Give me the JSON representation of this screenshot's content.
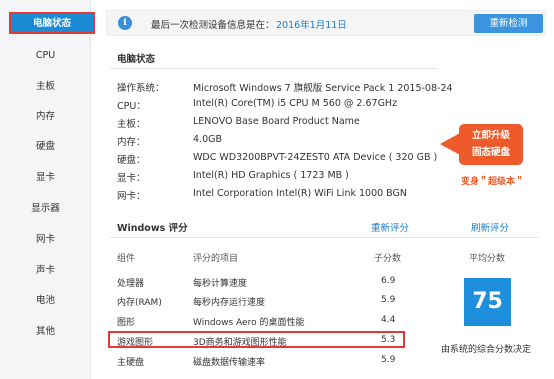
{
  "sidebar": {
    "items": [
      {
        "label": "电脑状态"
      },
      {
        "label": "CPU"
      },
      {
        "label": "主板"
      },
      {
        "label": "内存"
      },
      {
        "label": "硬盘"
      },
      {
        "label": "显卡"
      },
      {
        "label": "显示器"
      },
      {
        "label": "网卡"
      },
      {
        "label": "声卡"
      },
      {
        "label": "电池"
      },
      {
        "label": "其他"
      }
    ]
  },
  "topbar": {
    "icon": "info-icon",
    "icon_glyph": "i",
    "label": "最后一次检测设备信息是在：",
    "date": "2016年1月11日",
    "recheck_label": "重新检测"
  },
  "status": {
    "title": "电脑状态",
    "rows": [
      {
        "key": "操作系统：",
        "value": "Microsoft Windows 7 旗舰版  Service Pack 1  2015-08-24"
      },
      {
        "key": "CPU：",
        "value": "Intel(R) Core(TM) i5 CPU       M 560  @ 2.67GHz"
      },
      {
        "key": "主板：",
        "value": "LENOVO  Base Board Product Name"
      },
      {
        "key": "内存：",
        "value": "4.0GB"
      },
      {
        "key": "硬盘：",
        "value": "WDC WD3200BPVT-24ZEST0 ATA Device  ( 320 GB )"
      },
      {
        "key": "显卡：",
        "value": "Intel(R) HD Graphics  ( 1723 MB )"
      },
      {
        "key": "网卡：",
        "value": "Intel Corporation  Intel(R) WiFi Link 1000 BGN"
      }
    ]
  },
  "upgrade": {
    "line1": "立即升级",
    "line2": "固态硬盘",
    "sub": "变身＂超级本＂",
    "color": "#ef5a2a"
  },
  "score": {
    "title": "Windows 评分",
    "rescore_label": "重新评分",
    "refresh_label": "刷新评分",
    "headers": {
      "component": "组件",
      "item": "评分的项目",
      "sub": "子分数",
      "avg": "平均分数"
    },
    "rows": [
      {
        "component": "处理器",
        "item": "每秒计算速度",
        "sub": "6.9"
      },
      {
        "component": "内存(RAM)",
        "item": "每秒内存运行速度",
        "sub": "5.9"
      },
      {
        "component": "图形",
        "item": "Windows Aero 的桌面性能",
        "sub": "4.4"
      },
      {
        "component": "游戏图形",
        "item": "3D商务和游戏图形性能",
        "sub": "5.3"
      },
      {
        "component": "主硬盘",
        "item": "磁盘数据传输速率",
        "sub": "5.9"
      }
    ],
    "average": "75",
    "caption": "由系统的综合分数决定",
    "accent": "#1e8fdc"
  }
}
